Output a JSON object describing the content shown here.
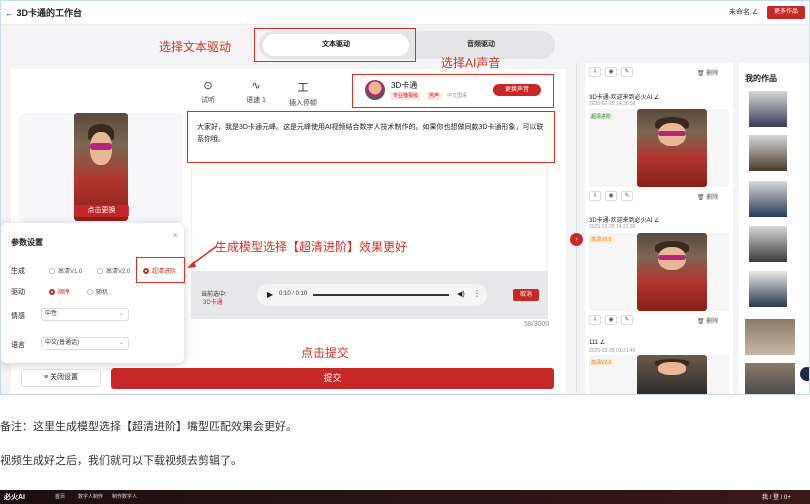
{
  "topbar": {
    "back_title": "← 3D卡通的工作台",
    "user": "未命名 ∠",
    "more": "更多作品"
  },
  "mode_tabs": [
    "文本驱动",
    "音频驱动"
  ],
  "toolbar": [
    {
      "icon": "play-circle-icon",
      "label": "试听"
    },
    {
      "icon": "waveform-icon",
      "label": "语速 1"
    },
    {
      "icon": "insert-pause-icon",
      "label": "插入停顿"
    }
  ],
  "voice": {
    "name": "3D卡通",
    "tags": [
      "专业播报级",
      "男声",
      "中文国语"
    ],
    "change_label": "更换声音"
  },
  "script_text": "大家好，我是3D卡通元峰。这是元峰使用AI视频结合数字人技术制作的。如果你也想做同款3D卡通形象，可以联系你哦。",
  "avatar": {
    "change_label": "点击更换"
  },
  "player": {
    "current_label": "当前选中:",
    "current_value": "3D卡通",
    "time": "0:10 / 0:10",
    "cancel_label": "取消"
  },
  "char_count": "58/3000",
  "settings": {
    "title": "参数设置",
    "gen_label": "生成",
    "gen_options": [
      "高清V1.0",
      "高清V2.0",
      "超清进阶"
    ],
    "gen_selected": "超清进阶",
    "action_label": "驱动",
    "action_options": [
      "顺序",
      "随机"
    ],
    "emotion_label": "情感",
    "emotion_value": "中性",
    "lang_label": "语言",
    "lang_value": "中文(普通话)"
  },
  "close_settings": "关闭设置",
  "submit": "提交",
  "works": [
    {
      "title": "",
      "date": "",
      "badge": ""
    },
    {
      "title": "3D卡通-欢迎来到必火AI ∠",
      "date": "2025-02-25 14:36:58",
      "badge": "超清进阶"
    },
    {
      "title": "3D卡通-欢迎来到必火AI ∠",
      "date": "2025-02-25 14:32:35",
      "badge": "高清V2.0"
    },
    {
      "title": "111 ∠",
      "date": "2025-02-25 01:21:45",
      "badge": "高清V2.0"
    }
  ],
  "work_delete": "删除",
  "my_works": "我的作品",
  "annotations": {
    "select_text": "选择文本驱动",
    "select_voice": "选择AI声音",
    "select_model": "生成模型选择【超清进阶】效果更好",
    "click_submit": "点击提交"
  },
  "notes": [
    "备注：这里生成模型选择【超清进阶】嘴型匹配效果会更好。",
    "视频生成好之后，我们就可以下载视频去剪辑了。"
  ],
  "footer": {
    "brand": "必火AI",
    "links": [
      "首页",
      "数字人制作",
      "制作数字人"
    ],
    "right": "我 / 登 / 0+"
  },
  "colors": {
    "accent": "#c62828",
    "annotation": "#d93025"
  }
}
